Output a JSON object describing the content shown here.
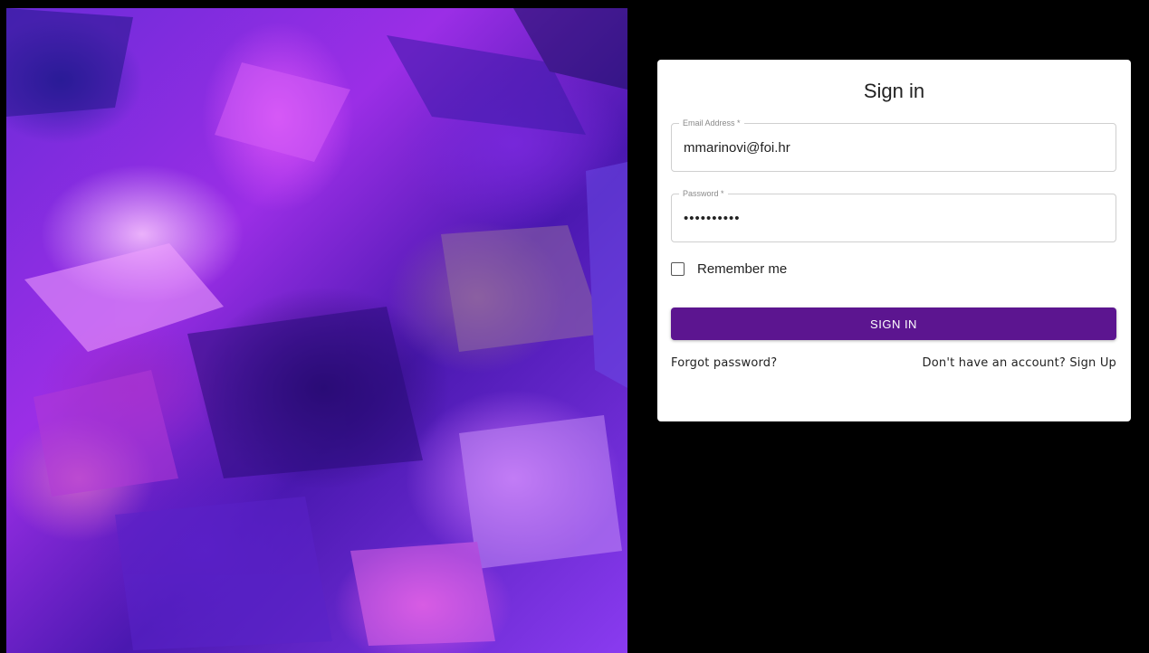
{
  "form": {
    "title": "Sign in",
    "email": {
      "label": "Email Address *",
      "value": "mmarinovi@foi.hr"
    },
    "password": {
      "label": "Password *",
      "value": "mmarinovi1"
    },
    "remember_me": {
      "label": "Remember me",
      "checked": false
    },
    "submit_label": "SIGN IN",
    "forgot_password_link": "Forgot password?",
    "signup_link": "Don't have an account? Sign Up"
  },
  "colors": {
    "page_background": "#000000",
    "card_background": "#ffffff",
    "primary_button": "#5c1590",
    "field_border": "#cfcfcf"
  },
  "icons": {
    "checkbox": "checkbox-unchecked-icon"
  }
}
